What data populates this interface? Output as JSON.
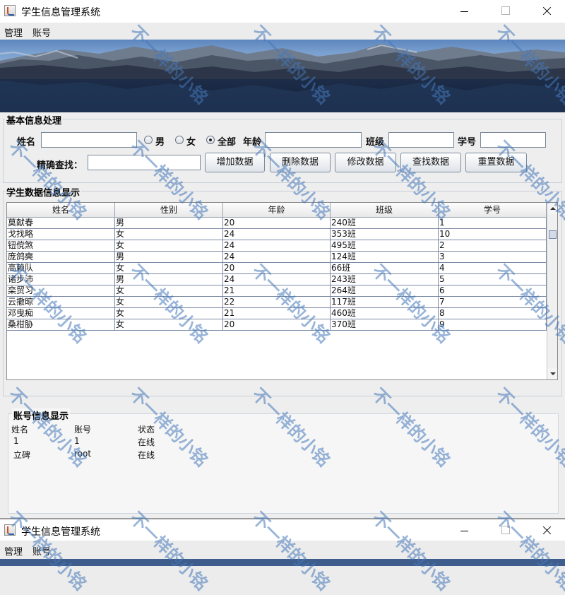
{
  "window": {
    "title": "学生信息管理系统",
    "menus": [
      "管理",
      "账号"
    ]
  },
  "basic_info": {
    "title": "基本信息处理",
    "name_label": "姓名",
    "gender_male": "男",
    "gender_female": "女",
    "gender_all": "全部",
    "gender_selected": "全部",
    "age_label": "年龄",
    "class_label": "班级",
    "id_label": "学号",
    "exact_search_label": "精确查找：",
    "buttons": {
      "add": "增加数据",
      "delete": "删除数据",
      "modify": "修改数据",
      "search": "查找数据",
      "reset": "重置数据"
    }
  },
  "student_table": {
    "title": "学生数据信息显示",
    "columns": [
      "姓名",
      "性别",
      "年龄",
      "班级",
      "学号"
    ],
    "rows": [
      [
        "莫献春",
        "男",
        "20",
        "240班",
        "1"
      ],
      [
        "戈找略",
        "女",
        "24",
        "353班",
        "10"
      ],
      [
        "钮傥煞",
        "女",
        "24",
        "495班",
        "2"
      ],
      [
        "庞鸽奭",
        "男",
        "24",
        "124班",
        "3"
      ],
      [
        "高赖队",
        "女",
        "20",
        "66班",
        "4"
      ],
      [
        "诸步沛",
        "男",
        "24",
        "243班",
        "5"
      ],
      [
        "栾贸习",
        "女",
        "21",
        "264班",
        "6"
      ],
      [
        "云撤晾",
        "女",
        "22",
        "117班",
        "7"
      ],
      [
        "邓曳痴",
        "女",
        "21",
        "460班",
        "8"
      ],
      [
        "桑柑胁",
        "女",
        "20",
        "370班",
        "9"
      ]
    ]
  },
  "account_info": {
    "title": "账号信息显示",
    "columns": [
      "姓名",
      "账号",
      "状态"
    ],
    "rows": [
      [
        "1",
        "1",
        "在线"
      ],
      [
        "立碑",
        "root",
        "在线"
      ]
    ]
  },
  "second_window": {
    "title": "学生信息管理系统",
    "menus": [
      "管理",
      "账号"
    ]
  },
  "watermark": "不一样的小铭"
}
